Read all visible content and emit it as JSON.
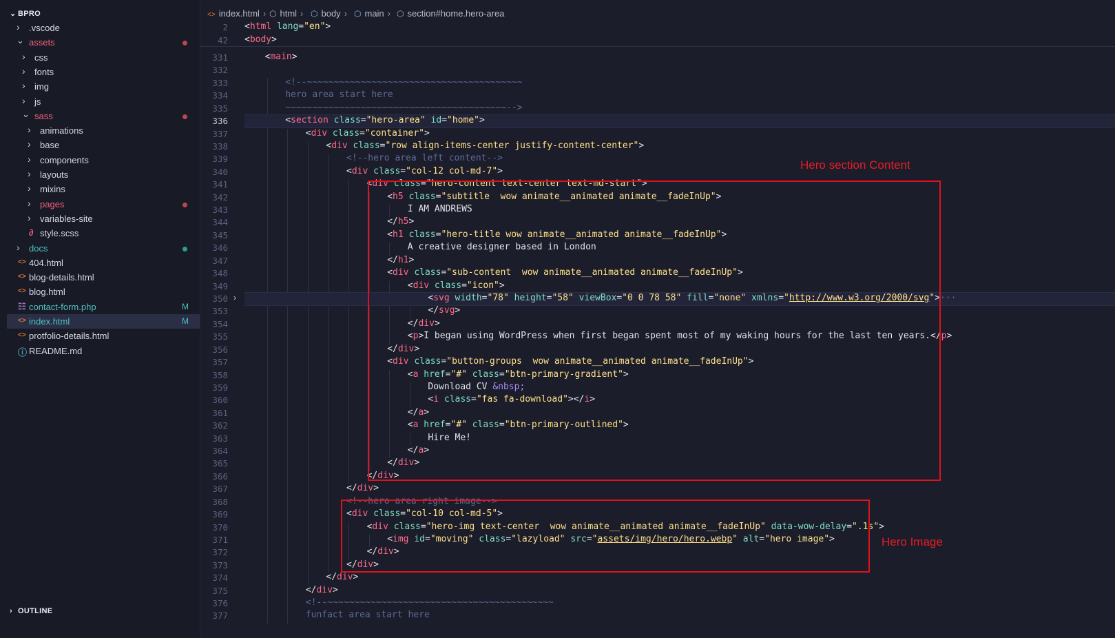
{
  "explorer": {
    "root": "BPRO",
    "items": [
      {
        "label": ".vscode",
        "type": "folder",
        "open": false,
        "depth": 1,
        "color": "#d5d7e0"
      },
      {
        "label": "assets",
        "type": "folder",
        "open": true,
        "depth": 1,
        "color": "#f0607a",
        "dot": "#c0464f"
      },
      {
        "label": "css",
        "type": "folder",
        "open": false,
        "depth": 2,
        "color": "#d5d7e0"
      },
      {
        "label": "fonts",
        "type": "folder",
        "open": false,
        "depth": 2,
        "color": "#d5d7e0"
      },
      {
        "label": "img",
        "type": "folder",
        "open": false,
        "depth": 2,
        "color": "#d5d7e0"
      },
      {
        "label": "js",
        "type": "folder",
        "open": false,
        "depth": 2,
        "color": "#d5d7e0"
      },
      {
        "label": "sass",
        "type": "folder",
        "open": true,
        "depth": 2,
        "color": "#f0607a",
        "dot": "#c0464f"
      },
      {
        "label": "animations",
        "type": "folder",
        "open": false,
        "depth": 3,
        "color": "#d5d7e0"
      },
      {
        "label": "base",
        "type": "folder",
        "open": false,
        "depth": 3,
        "color": "#d5d7e0"
      },
      {
        "label": "components",
        "type": "folder",
        "open": false,
        "depth": 3,
        "color": "#d5d7e0"
      },
      {
        "label": "layouts",
        "type": "folder",
        "open": false,
        "depth": 3,
        "color": "#d5d7e0"
      },
      {
        "label": "mixins",
        "type": "folder",
        "open": false,
        "depth": 3,
        "color": "#d5d7e0"
      },
      {
        "label": "pages",
        "type": "folder",
        "open": false,
        "depth": 3,
        "color": "#f0607a",
        "dot": "#c0464f"
      },
      {
        "label": "variables-site",
        "type": "folder",
        "open": false,
        "depth": 3,
        "color": "#d5d7e0"
      },
      {
        "label": "style.scss",
        "type": "scss",
        "depth": 3,
        "color": "#d5d7e0"
      },
      {
        "label": "docs",
        "type": "folder",
        "open": false,
        "depth": 1,
        "color": "#4fc1c0",
        "dot": "#2f9c95"
      },
      {
        "label": "404.html",
        "type": "html",
        "depth": 1,
        "color": "#d5d7e0"
      },
      {
        "label": "blog-details.html",
        "type": "html",
        "depth": 1,
        "color": "#d5d7e0"
      },
      {
        "label": "blog.html",
        "type": "html",
        "depth": 1,
        "color": "#d5d7e0"
      },
      {
        "label": "contact-form.php",
        "type": "php",
        "depth": 1,
        "color": "#4fc1c0",
        "badge": "M"
      },
      {
        "label": "index.html",
        "type": "html",
        "depth": 1,
        "color": "#4fc1c0",
        "badge": "M",
        "active": true
      },
      {
        "label": "protfolio-details.html",
        "type": "html",
        "depth": 1,
        "color": "#d5d7e0"
      },
      {
        "label": "README.md",
        "type": "info",
        "depth": 1,
        "color": "#d5d7e0"
      }
    ],
    "outline_title": "OUTLINE"
  },
  "breadcrumb": [
    "index.html",
    "html",
    "body",
    "main",
    "section#home.hero-area"
  ],
  "sticky": [
    {
      "n": "2",
      "indent": 0,
      "segs": [
        [
          "br",
          "<"
        ],
        [
          "tag",
          "html"
        ],
        [
          "attr",
          " lang"
        ],
        [
          "br",
          "="
        ],
        [
          "str",
          "\"en\""
        ],
        [
          "br",
          ">"
        ]
      ]
    },
    {
      "n": "42",
      "indent": 0,
      "segs": [
        [
          "br",
          "<"
        ],
        [
          "tag",
          "body"
        ],
        [
          "br",
          ">"
        ]
      ]
    }
  ],
  "lines": [
    {
      "n": "331",
      "indent": 1,
      "segs": [
        [
          "br",
          "<"
        ],
        [
          "tag",
          "main"
        ],
        [
          "br",
          ">"
        ]
      ]
    },
    {
      "n": "332",
      "indent": 0,
      "segs": []
    },
    {
      "n": "333",
      "indent": 2,
      "segs": [
        [
          "cmt",
          "<!--~~~~~~~~~~~~~~~~~~~~~~~~~~~~~~~~~~~~~~~~"
        ]
      ]
    },
    {
      "n": "334",
      "indent": 2,
      "segs": [
        [
          "cmt",
          "hero area start here"
        ]
      ]
    },
    {
      "n": "335",
      "indent": 2,
      "segs": [
        [
          "cmt",
          "~~~~~~~~~~~~~~~~~~~~~~~~~~~~~~~~~~~~~~~~~-->"
        ]
      ]
    },
    {
      "n": "336",
      "indent": 2,
      "current": true,
      "segs": [
        [
          "br",
          "<"
        ],
        [
          "tag",
          "section"
        ],
        [
          "attr",
          " class"
        ],
        [
          "br",
          "="
        ],
        [
          "str",
          "\"hero-area\""
        ],
        [
          "attr",
          " id"
        ],
        [
          "br",
          "="
        ],
        [
          "str",
          "\"home\""
        ],
        [
          "br",
          ">"
        ]
      ]
    },
    {
      "n": "337",
      "indent": 3,
      "segs": [
        [
          "br",
          "<"
        ],
        [
          "tag",
          "div"
        ],
        [
          "attr",
          " class"
        ],
        [
          "br",
          "="
        ],
        [
          "str",
          "\"container\""
        ],
        [
          "br",
          ">"
        ]
      ]
    },
    {
      "n": "338",
      "indent": 4,
      "segs": [
        [
          "br",
          "<"
        ],
        [
          "tag",
          "div"
        ],
        [
          "attr",
          " class"
        ],
        [
          "br",
          "="
        ],
        [
          "str",
          "\"row align-items-center justify-content-center\""
        ],
        [
          "br",
          ">"
        ]
      ]
    },
    {
      "n": "339",
      "indent": 5,
      "segs": [
        [
          "cmt",
          "<!--hero area left content-->"
        ]
      ]
    },
    {
      "n": "340",
      "indent": 5,
      "segs": [
        [
          "br",
          "<"
        ],
        [
          "tag",
          "div"
        ],
        [
          "attr",
          " class"
        ],
        [
          "br",
          "="
        ],
        [
          "str",
          "\"col-12 col-md-7\""
        ],
        [
          "br",
          ">"
        ]
      ]
    },
    {
      "n": "341",
      "indent": 6,
      "segs": [
        [
          "br",
          "<"
        ],
        [
          "tag",
          "div"
        ],
        [
          "attr",
          " class"
        ],
        [
          "br",
          "="
        ],
        [
          "str",
          "\"hero-content text-center text-md-start\""
        ],
        [
          "br",
          ">"
        ]
      ]
    },
    {
      "n": "342",
      "indent": 7,
      "segs": [
        [
          "br",
          "<"
        ],
        [
          "tag",
          "h5"
        ],
        [
          "attr",
          " class"
        ],
        [
          "br",
          "="
        ],
        [
          "str",
          "\"subtitle  wow animate__animated animate__fadeInUp\""
        ],
        [
          "br",
          ">"
        ]
      ]
    },
    {
      "n": "343",
      "indent": 8,
      "segs": [
        [
          "br",
          "I AM ANDREWS"
        ]
      ]
    },
    {
      "n": "344",
      "indent": 7,
      "segs": [
        [
          "br",
          "</"
        ],
        [
          "tag",
          "h5"
        ],
        [
          "br",
          ">"
        ]
      ]
    },
    {
      "n": "345",
      "indent": 7,
      "segs": [
        [
          "br",
          "<"
        ],
        [
          "tag",
          "h1"
        ],
        [
          "attr",
          " class"
        ],
        [
          "br",
          "="
        ],
        [
          "str",
          "\"hero-title wow animate__animated animate__fadeInUp\""
        ],
        [
          "br",
          ">"
        ]
      ]
    },
    {
      "n": "346",
      "indent": 8,
      "segs": [
        [
          "br",
          "A creative designer based in London"
        ]
      ]
    },
    {
      "n": "347",
      "indent": 7,
      "segs": [
        [
          "br",
          "</"
        ],
        [
          "tag",
          "h1"
        ],
        [
          "br",
          ">"
        ]
      ]
    },
    {
      "n": "348",
      "indent": 7,
      "segs": [
        [
          "br",
          "<"
        ],
        [
          "tag",
          "div"
        ],
        [
          "attr",
          " class"
        ],
        [
          "br",
          "="
        ],
        [
          "str",
          "\"sub-content  wow animate__animated animate__fadeInUp\""
        ],
        [
          "br",
          ">"
        ]
      ]
    },
    {
      "n": "349",
      "indent": 8,
      "segs": [
        [
          "br",
          "<"
        ],
        [
          "tag",
          "div"
        ],
        [
          "attr",
          " class"
        ],
        [
          "br",
          "="
        ],
        [
          "str",
          "\"icon\""
        ],
        [
          "br",
          ">"
        ]
      ]
    },
    {
      "n": "350",
      "indent": 9,
      "folded": true,
      "segs": [
        [
          "br",
          "<"
        ],
        [
          "tag",
          "svg"
        ],
        [
          "attr",
          " width"
        ],
        [
          "br",
          "="
        ],
        [
          "str",
          "\"78\""
        ],
        [
          "attr",
          " height"
        ],
        [
          "br",
          "="
        ],
        [
          "str",
          "\"58\""
        ],
        [
          "attr",
          " viewBox"
        ],
        [
          "br",
          "="
        ],
        [
          "str",
          "\"0 0 78 58\""
        ],
        [
          "attr",
          " fill"
        ],
        [
          "br",
          "="
        ],
        [
          "str",
          "\"none\""
        ],
        [
          "attr",
          " xmlns"
        ],
        [
          "br",
          "="
        ],
        [
          "str",
          "\""
        ],
        [
          "url",
          "http://www.w3.org/2000/svg"
        ],
        [
          "str",
          "\""
        ],
        [
          "br",
          ">"
        ],
        [
          "cmt",
          "···"
        ]
      ]
    },
    {
      "n": "353",
      "indent": 9,
      "segs": [
        [
          "br",
          "</"
        ],
        [
          "tag",
          "svg"
        ],
        [
          "br",
          ">"
        ]
      ]
    },
    {
      "n": "354",
      "indent": 8,
      "segs": [
        [
          "br",
          "</"
        ],
        [
          "tag",
          "div"
        ],
        [
          "br",
          ">"
        ]
      ]
    },
    {
      "n": "355",
      "indent": 8,
      "segs": [
        [
          "br",
          "<"
        ],
        [
          "tag",
          "p"
        ],
        [
          "br",
          ">I began using WordPress when first began spent most of my waking hours for the last ten years.</"
        ],
        [
          "tag",
          "p"
        ],
        [
          "br",
          ">"
        ]
      ]
    },
    {
      "n": "356",
      "indent": 7,
      "segs": [
        [
          "br",
          "</"
        ],
        [
          "tag",
          "div"
        ],
        [
          "br",
          ">"
        ]
      ]
    },
    {
      "n": "357",
      "indent": 7,
      "segs": [
        [
          "br",
          "<"
        ],
        [
          "tag",
          "div"
        ],
        [
          "attr",
          " class"
        ],
        [
          "br",
          "="
        ],
        [
          "str",
          "\"button-groups  wow animate__animated animate__fadeInUp\""
        ],
        [
          "br",
          ">"
        ]
      ]
    },
    {
      "n": "358",
      "indent": 8,
      "segs": [
        [
          "br",
          "<"
        ],
        [
          "tag",
          "a"
        ],
        [
          "attr",
          " href"
        ],
        [
          "br",
          "="
        ],
        [
          "str",
          "\"#\""
        ],
        [
          "attr",
          " class"
        ],
        [
          "br",
          "="
        ],
        [
          "str",
          "\"btn-primary-gradient\""
        ],
        [
          "br",
          ">"
        ]
      ]
    },
    {
      "n": "359",
      "indent": 9,
      "segs": [
        [
          "br",
          "Download CV "
        ],
        [
          "ent",
          "&nbsp;"
        ]
      ]
    },
    {
      "n": "360",
      "indent": 9,
      "segs": [
        [
          "br",
          "<"
        ],
        [
          "tag",
          "i"
        ],
        [
          "attr",
          " class"
        ],
        [
          "br",
          "="
        ],
        [
          "str",
          "\"fas fa-download\""
        ],
        [
          "br",
          "></"
        ],
        [
          "tag",
          "i"
        ],
        [
          "br",
          ">"
        ]
      ]
    },
    {
      "n": "361",
      "indent": 8,
      "segs": [
        [
          "br",
          "</"
        ],
        [
          "tag",
          "a"
        ],
        [
          "br",
          ">"
        ]
      ]
    },
    {
      "n": "362",
      "indent": 8,
      "segs": [
        [
          "br",
          "<"
        ],
        [
          "tag",
          "a"
        ],
        [
          "attr",
          " href"
        ],
        [
          "br",
          "="
        ],
        [
          "str",
          "\"#\""
        ],
        [
          "attr",
          " class"
        ],
        [
          "br",
          "="
        ],
        [
          "str",
          "\"btn-primary-outlined\""
        ],
        [
          "br",
          ">"
        ]
      ]
    },
    {
      "n": "363",
      "indent": 9,
      "segs": [
        [
          "br",
          "Hire Me!"
        ]
      ]
    },
    {
      "n": "364",
      "indent": 8,
      "segs": [
        [
          "br",
          "</"
        ],
        [
          "tag",
          "a"
        ],
        [
          "br",
          ">"
        ]
      ]
    },
    {
      "n": "365",
      "indent": 7,
      "segs": [
        [
          "br",
          "</"
        ],
        [
          "tag",
          "div"
        ],
        [
          "br",
          ">"
        ]
      ]
    },
    {
      "n": "366",
      "indent": 6,
      "segs": [
        [
          "br",
          "</"
        ],
        [
          "tag",
          "div"
        ],
        [
          "br",
          ">"
        ]
      ]
    },
    {
      "n": "367",
      "indent": 5,
      "segs": [
        [
          "br",
          "</"
        ],
        [
          "tag",
          "div"
        ],
        [
          "br",
          ">"
        ]
      ]
    },
    {
      "n": "368",
      "indent": 5,
      "segs": [
        [
          "cmt",
          "<!--hero area right image-->"
        ]
      ]
    },
    {
      "n": "369",
      "indent": 5,
      "segs": [
        [
          "br",
          "<"
        ],
        [
          "tag",
          "div"
        ],
        [
          "attr",
          " class"
        ],
        [
          "br",
          "="
        ],
        [
          "str",
          "\"col-10 col-md-5\""
        ],
        [
          "br",
          ">"
        ]
      ]
    },
    {
      "n": "370",
      "indent": 6,
      "segs": [
        [
          "br",
          "<"
        ],
        [
          "tag",
          "div"
        ],
        [
          "attr",
          " class"
        ],
        [
          "br",
          "="
        ],
        [
          "str",
          "\"hero-img text-center  wow animate__animated animate__fadeInUp\""
        ],
        [
          "attr",
          " data-wow-delay"
        ],
        [
          "br",
          "="
        ],
        [
          "str",
          "\".1s\""
        ],
        [
          "br",
          ">"
        ]
      ]
    },
    {
      "n": "371",
      "indent": 7,
      "segs": [
        [
          "br",
          "<"
        ],
        [
          "tag",
          "img"
        ],
        [
          "attr",
          " id"
        ],
        [
          "br",
          "="
        ],
        [
          "str",
          "\"moving\""
        ],
        [
          "attr",
          " class"
        ],
        [
          "br",
          "="
        ],
        [
          "str",
          "\"lazyload\""
        ],
        [
          "attr",
          " src"
        ],
        [
          "br",
          "="
        ],
        [
          "str",
          "\""
        ],
        [
          "url",
          "assets/img/hero/hero.webp"
        ],
        [
          "str",
          "\""
        ],
        [
          "attr",
          " alt"
        ],
        [
          "br",
          "="
        ],
        [
          "str",
          "\"hero image\""
        ],
        [
          "br",
          ">"
        ]
      ]
    },
    {
      "n": "372",
      "indent": 6,
      "segs": [
        [
          "br",
          "</"
        ],
        [
          "tag",
          "div"
        ],
        [
          "br",
          ">"
        ]
      ]
    },
    {
      "n": "373",
      "indent": 5,
      "segs": [
        [
          "br",
          "</"
        ],
        [
          "tag",
          "div"
        ],
        [
          "br",
          ">"
        ]
      ]
    },
    {
      "n": "374",
      "indent": 4,
      "segs": [
        [
          "br",
          "</"
        ],
        [
          "tag",
          "div"
        ],
        [
          "br",
          ">"
        ]
      ]
    },
    {
      "n": "375",
      "indent": 3,
      "segs": [
        [
          "br",
          "</"
        ],
        [
          "tag",
          "div"
        ],
        [
          "br",
          ">"
        ]
      ]
    },
    {
      "n": "376",
      "indent": 3,
      "segs": [
        [
          "cmt",
          "<!--~~~~~~~~~~~~~~~~~~~~~~~~~~~~~~~~~~~~~~~~~~"
        ]
      ]
    },
    {
      "n": "377",
      "indent": 3,
      "segs": [
        [
          "cmt",
          "funfact area start here"
        ]
      ]
    }
  ],
  "annotations": [
    {
      "label": "Hero section Content"
    },
    {
      "label": "Hero Image"
    }
  ]
}
